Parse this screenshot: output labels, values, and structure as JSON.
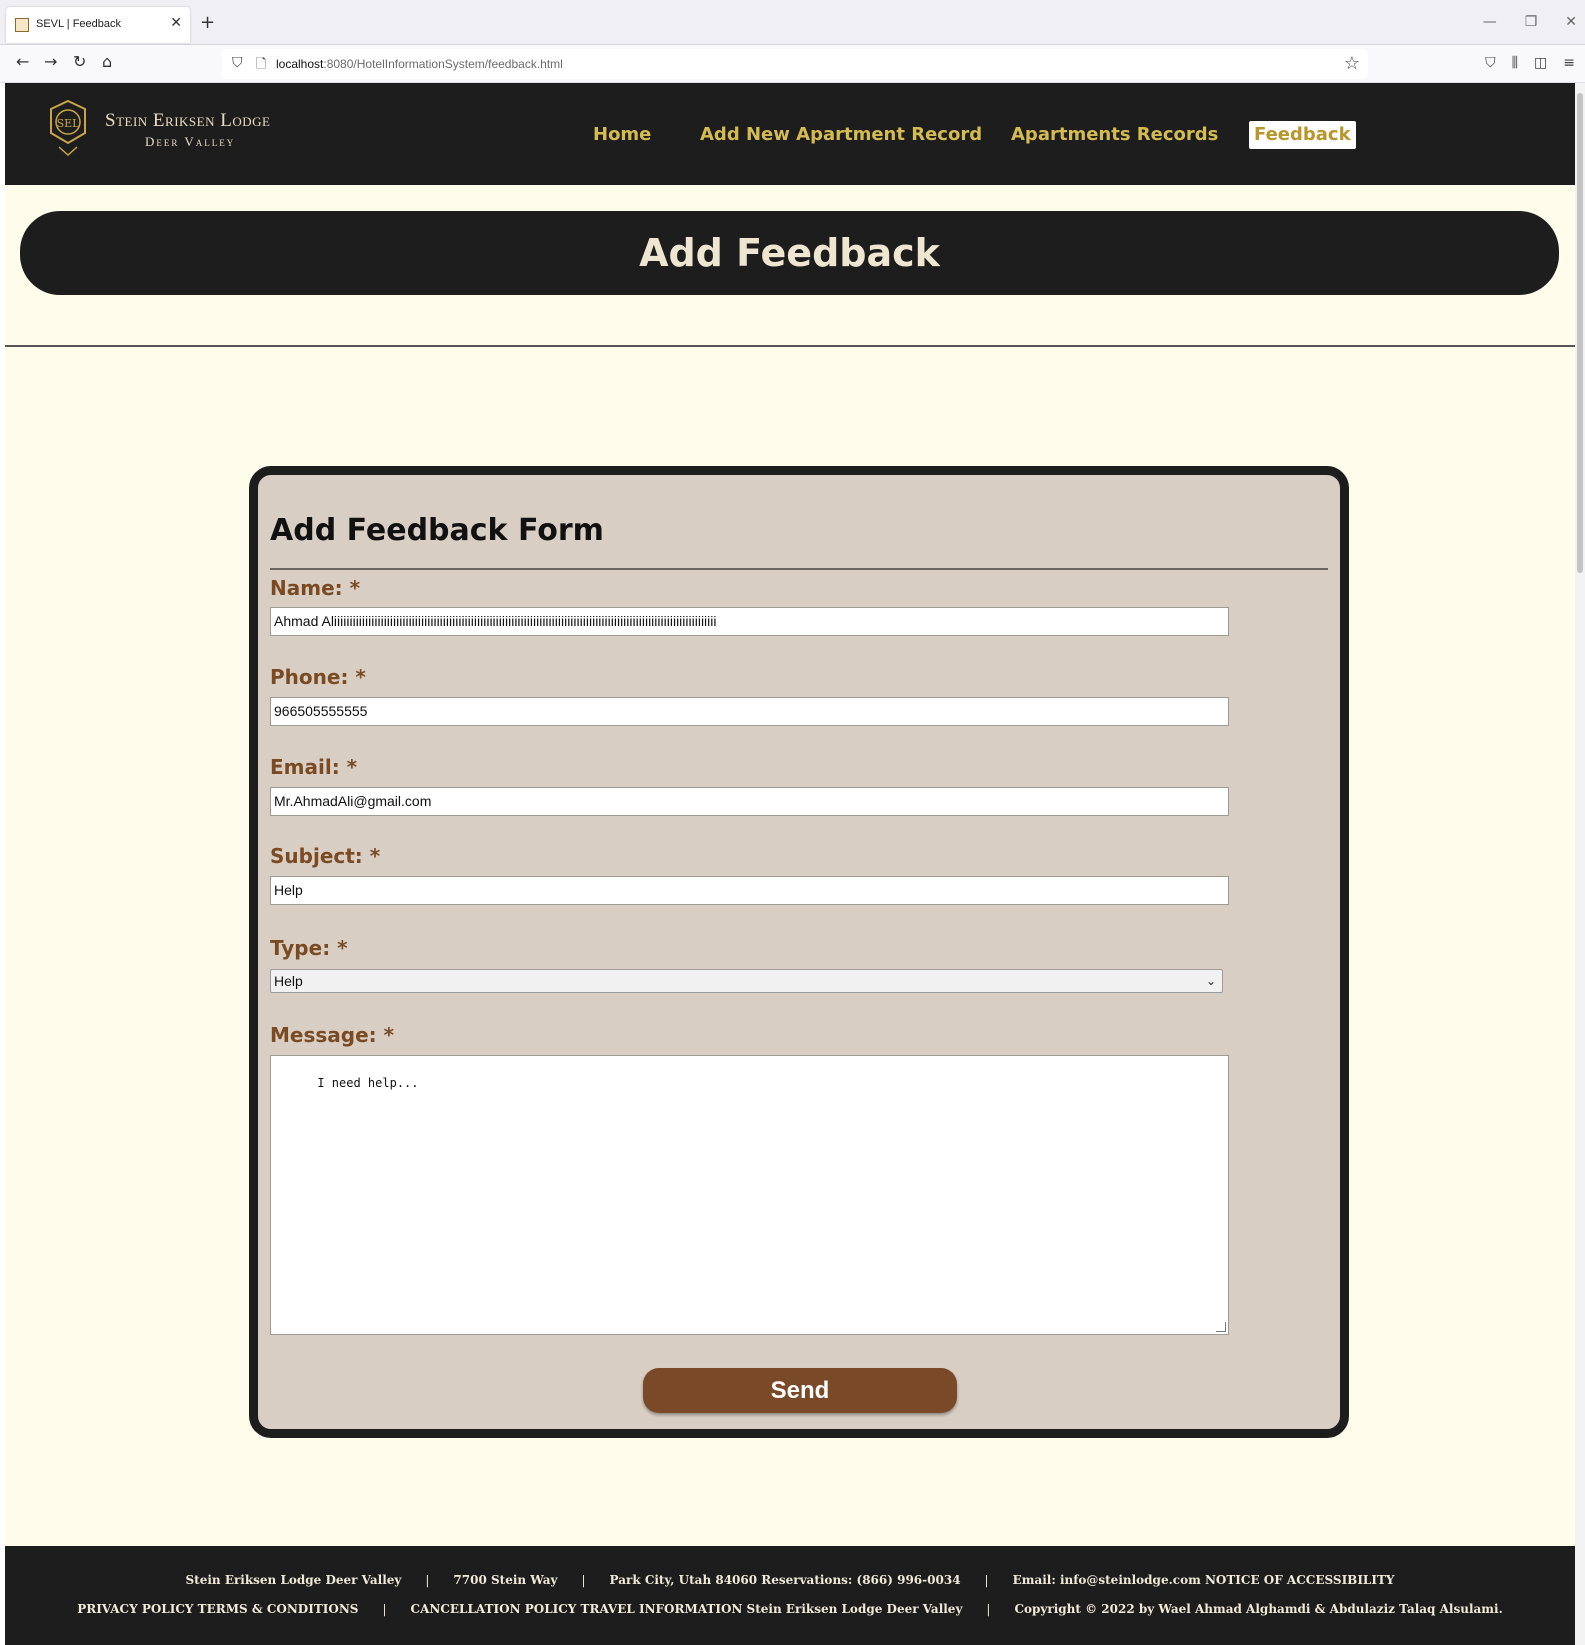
{
  "browser": {
    "tab_title": "SEVL | Feedback",
    "url_host": "localhost",
    "url_rest": ":8080/HotelInformationSystem/feedback.html"
  },
  "site": {
    "logo_name": "Stein Eriksen Lodge",
    "logo_sub": "Deer Valley",
    "nav": [
      {
        "label": "Home",
        "active": false
      },
      {
        "label": "Add New Apartment Record",
        "active": false
      },
      {
        "label": "Apartments Records",
        "active": false
      },
      {
        "label": "Feedback",
        "active": true
      }
    ]
  },
  "hero": {
    "title": "Add Feedback"
  },
  "form": {
    "title": "Add Feedback Form",
    "name_label": "Name: *",
    "name_value": "Ahmad Aliiiiiiiiiiiiiiiiiiiiiiiiiiiiiiiiiiiiiiiiiiiiiiiiiiiiiiiiiiiiiiiiiiiiiiiiiiiiiiiiiiiiiiiiiiiiiiiiiiiiiiiiiiiiiiiiiiiiiiiiiii",
    "phone_label": "Phone: *",
    "phone_value": "966505555555",
    "email_label": "Email: *",
    "email_value": "Mr.AhmadAli@gmail.com",
    "subject_label": "Subject: *",
    "subject_value": "Help",
    "type_label": "Type: *",
    "type_value": "Help",
    "message_label": "Message: *",
    "message_value": "I need help...",
    "send_label": "Send"
  },
  "footer": {
    "row1": [
      "Stein Eriksen Lodge Deer Valley",
      "7700 Stein Way",
      "Park City, Utah 84060 Reservations: (866) 996-0034",
      "Email: info@steinlodge.com NOTICE OF ACCESSIBILITY"
    ],
    "row2": [
      "PRIVACY POLICY TERMS & CONDITIONS",
      "CANCELLATION POLICY TRAVEL INFORMATION Stein Eriksen Lodge Deer Valley",
      "Copyright © 2022 by Wael Ahmad Alghamdi & Abdulaziz Talaq Alsulami."
    ]
  },
  "colors": {
    "header_bg": "#1d1d1d",
    "page_bg": "#fffcec",
    "nav_link": "#d4bb52",
    "form_bg": "#d8cec4",
    "label": "#7a4a22",
    "button": "#7a4a28"
  }
}
